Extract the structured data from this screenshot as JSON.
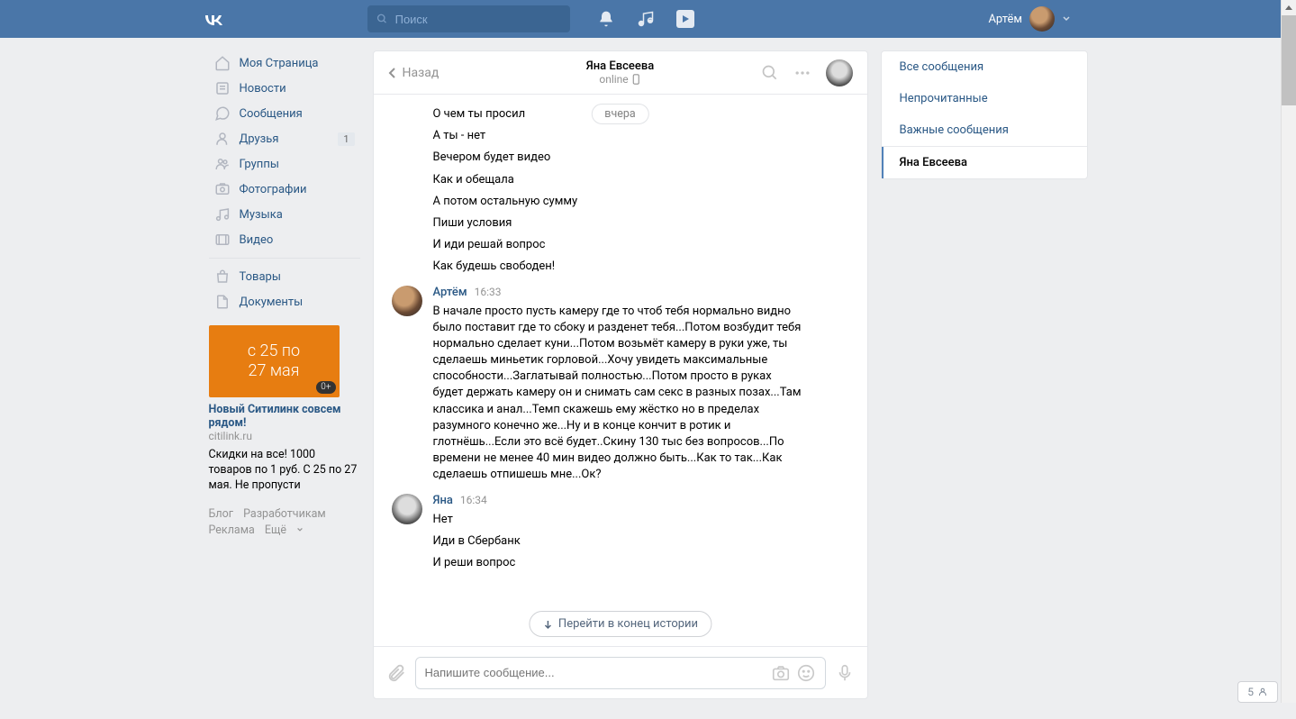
{
  "topbar": {
    "search_placeholder": "Поиск",
    "username": "Артём"
  },
  "nav": {
    "my_page": "Моя Страница",
    "news": "Новости",
    "messages": "Сообщения",
    "friends": "Друзья",
    "friends_badge": "1",
    "groups": "Группы",
    "photos": "Фотографии",
    "music": "Музыка",
    "videos": "Видео",
    "market": "Товары",
    "docs": "Документы"
  },
  "ad": {
    "line1": "с 25 по",
    "line2": "27 мая",
    "badge": "0+",
    "title": "Новый Ситилинк совсем рядом!",
    "domain": "citilink.ru",
    "text": "Скидки на все! 1000 товаров по 1 руб. С 25 по 27 мая. Не пропусти"
  },
  "footer": {
    "blog": "Блог",
    "devs": "Разработчикам",
    "ads": "Реклама",
    "more": "Ещё"
  },
  "chat_header": {
    "back": "Назад",
    "title": "Яна Евсеева",
    "status": "online"
  },
  "date_pill": "вчера",
  "prelines": {
    "l1": "О чем ты просил",
    "l2": "А ты - нет",
    "l3": "Вечером будет видео",
    "l4": "Как и обещала",
    "l5": "А потом остальную сумму",
    "l6": "Пиши условия",
    "l7": "И иди решай вопрос",
    "l8": "Как будешь свободен!"
  },
  "msg1": {
    "name": "Артём",
    "time": "16:33",
    "text": "В начале просто пусть камеру где то чтоб тебя нормально видно было поставит где то сбоку и разденет тебя...Потом возбудит тебя нормально сделает куни...Потом возьмёт камеру в руки уже, ты сделаешь миньетик горловой...Хочу увидеть максимальные способности...Заглатывай полностью...Потом просто в руках будет держать камеру он и снимать сам секс в разных позах...Там классика и анал...Темп скажешь ему жёстко но в пределах разумного конечно же...Ну и в конце кончит в ротик и глотнёшь...Если это всё будет..Скину 130 тыс без вопросов...По времени не менее 40 мин видео должно быть...Как то так...Как сделаешь отпишешь мне...Ок?"
  },
  "msg2": {
    "name": "Яна",
    "time": "16:34",
    "l1": "Нет",
    "l2": "Иди в Сбербанк",
    "l3": "И реши вопрос"
  },
  "jump_label": "Перейти в конец истории",
  "composer_placeholder": "Напишите сообщение...",
  "right_filters": {
    "all": "Все сообщения",
    "unread": "Непрочитанные",
    "important": "Важные сообщения",
    "active": "Яна Евсеева"
  },
  "like_count": "5"
}
